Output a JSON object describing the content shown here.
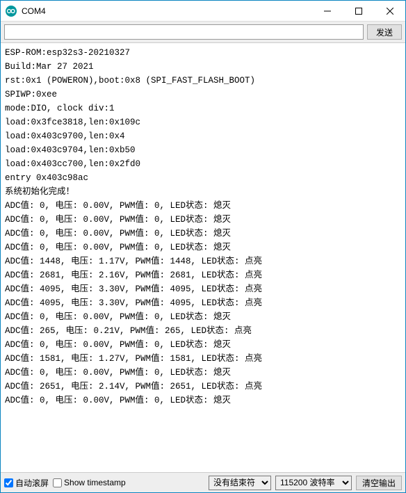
{
  "window": {
    "title": "COM4"
  },
  "toolbar": {
    "send_label": "发送",
    "input_value": "",
    "input_placeholder": ""
  },
  "console_lines": [
    "ESP-ROM:esp32s3-20210327",
    "Build:Mar 27 2021",
    "rst:0x1 (POWERON),boot:0x8 (SPI_FAST_FLASH_BOOT)",
    "SPIWP:0xee",
    "mode:DIO, clock div:1",
    "load:0x3fce3818,len:0x109c",
    "load:0x403c9700,len:0x4",
    "load:0x403c9704,len:0xb50",
    "load:0x403cc700,len:0x2fd0",
    "entry 0x403c98ac",
    "系统初始化完成！",
    "ADC值: 0, 电压: 0.00V, PWM值: 0, LED状态: 熄灭",
    "ADC值: 0, 电压: 0.00V, PWM值: 0, LED状态: 熄灭",
    "ADC值: 0, 电压: 0.00V, PWM值: 0, LED状态: 熄灭",
    "ADC值: 0, 电压: 0.00V, PWM值: 0, LED状态: 熄灭",
    "ADC值: 1448, 电压: 1.17V, PWM值: 1448, LED状态: 点亮",
    "ADC值: 2681, 电压: 2.16V, PWM值: 2681, LED状态: 点亮",
    "ADC值: 4095, 电压: 3.30V, PWM值: 4095, LED状态: 点亮",
    "ADC值: 4095, 电压: 3.30V, PWM值: 4095, LED状态: 点亮",
    "ADC值: 0, 电压: 0.00V, PWM值: 0, LED状态: 熄灭",
    "ADC值: 265, 电压: 0.21V, PWM值: 265, LED状态: 点亮",
    "ADC值: 0, 电压: 0.00V, PWM值: 0, LED状态: 熄灭",
    "ADC值: 1581, 电压: 1.27V, PWM值: 1581, LED状态: 点亮",
    "ADC值: 0, 电压: 0.00V, PWM值: 0, LED状态: 熄灭",
    "ADC值: 2651, 电压: 2.14V, PWM值: 2651, LED状态: 点亮",
    "ADC值: 0, 电压: 0.00V, PWM值: 0, LED状态: 熄灭"
  ],
  "statusbar": {
    "autoscroll_label": "自动滚屏",
    "autoscroll_checked": true,
    "timestamp_label": "Show timestamp",
    "timestamp_checked": false,
    "line_ending_selected": "没有结束符",
    "baud_selected": "115200 波特率",
    "clear_label": "清空输出"
  }
}
